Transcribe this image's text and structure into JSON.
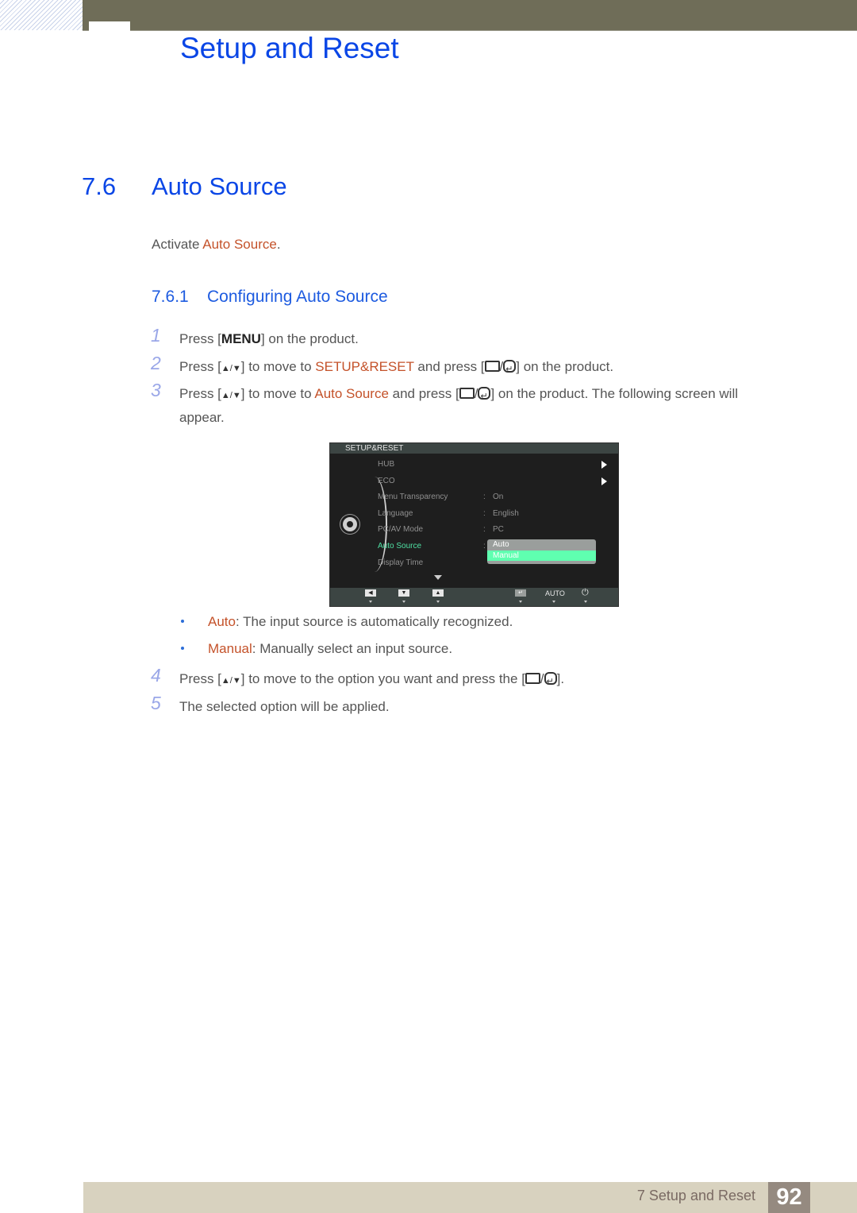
{
  "header": {
    "chapter_title": "Setup and Reset",
    "bar_color": "#6f6d58",
    "accent": "#0a46e6"
  },
  "section": {
    "number": "7.6",
    "title": "Auto Source",
    "intro_prefix": "Activate ",
    "intro_link": "Auto Source",
    "intro_suffix": "."
  },
  "subsection": {
    "number": "7.6.1",
    "title": "Configuring Auto Source"
  },
  "steps": [
    {
      "num": "1",
      "pre": "Press [",
      "key": "MENU",
      "post": "] on the product."
    },
    {
      "num": "2",
      "pre": "Press [",
      "arrows": "▲/▼",
      "mid": "] to move to ",
      "target": "SETUP&RESET",
      "mid2": " and press [",
      "post": "] on the product."
    },
    {
      "num": "3",
      "pre": "Press [",
      "arrows": "▲/▼",
      "mid": "] to move to ",
      "target": "Auto Source",
      "mid2": " and press [",
      "post": "] on the product. The following screen will",
      "cont": "appear."
    },
    {
      "num": "4",
      "pre": "Press [",
      "arrows": "▲/▼",
      "mid": "] to move to the option you want and press the [",
      "post": "]."
    },
    {
      "num": "5",
      "text": "The selected option will be applied."
    }
  ],
  "bullets": [
    {
      "term": "Auto",
      "desc": ": The input source is automatically recognized."
    },
    {
      "term": "Manual",
      "desc": ": Manually select an input source."
    }
  ],
  "osd": {
    "header": "SETUP&RESET",
    "items": [
      {
        "label": "HUB",
        "value": "",
        "submenu": true
      },
      {
        "label": "ECO",
        "value": "",
        "submenu": true
      },
      {
        "label": "Menu Transparency",
        "value": "On"
      },
      {
        "label": "Language",
        "value": "English"
      },
      {
        "label": "PC/AV Mode",
        "value": "PC"
      },
      {
        "label": "Auto Source",
        "value": "",
        "active": true
      },
      {
        "label": "Display Time",
        "value": ""
      }
    ],
    "separator": ":",
    "dropdown_options": [
      "Auto",
      "Manual"
    ],
    "dropdown_selected": "Manual",
    "footer_auto": "AUTO",
    "active_color": "#4fe0a3"
  },
  "footer": {
    "label": "7 Setup and Reset",
    "page": "92"
  }
}
